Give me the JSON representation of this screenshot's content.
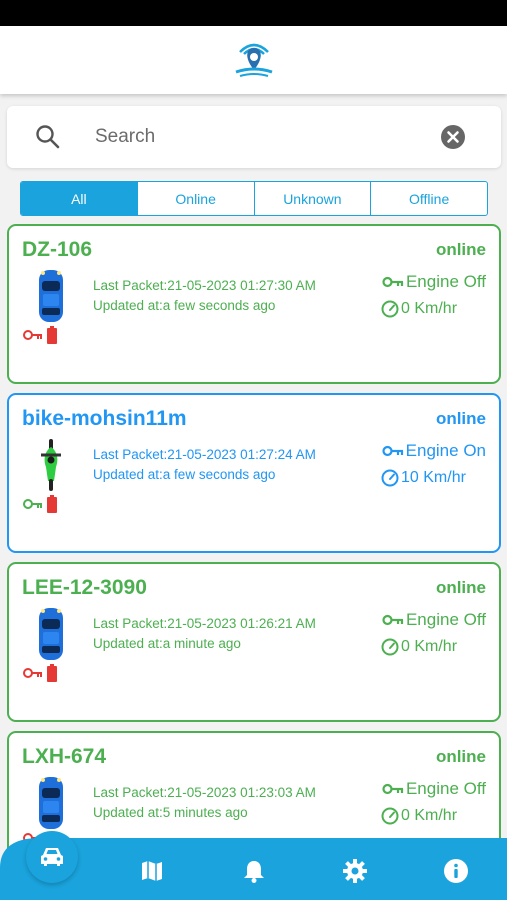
{
  "search": {
    "placeholder": "Search"
  },
  "tabs": [
    {
      "label": "All",
      "active": true
    },
    {
      "label": "Online"
    },
    {
      "label": "Unknown"
    },
    {
      "label": "Offline"
    }
  ],
  "vehicles": [
    {
      "name": "DZ-106",
      "status": "online",
      "last_packet": "Last Packet:21-05-2023 01:27:30 AM",
      "updated": "Updated at:a few seconds ago",
      "engine": "Engine Off",
      "speed": "0 Km/hr",
      "type": "car",
      "color": "#4caf50"
    },
    {
      "name": "bike-mohsin11m",
      "status": "online",
      "last_packet": "Last Packet:21-05-2023 01:27:24 AM",
      "updated": "Updated at:a few seconds ago",
      "engine": "Engine On",
      "speed": "10 Km/hr",
      "type": "bike",
      "color": "#2196f3"
    },
    {
      "name": "LEE-12-3090",
      "status": "online",
      "last_packet": "Last Packet:21-05-2023 01:26:21 AM",
      "updated": "Updated at:a minute ago",
      "engine": "Engine Off",
      "speed": "0 Km/hr",
      "type": "car",
      "color": "#4caf50"
    },
    {
      "name": "LXH-674",
      "status": "online",
      "last_packet": "Last Packet:21-05-2023 01:23:03 AM",
      "updated": "Updated at:5 minutes ago",
      "engine": "Engine Off",
      "speed": "0 Km/hr",
      "type": "car",
      "color": "#4caf50"
    }
  ],
  "nav": {
    "items": [
      "car-icon",
      "map-icon",
      "bell-icon",
      "gear-icon",
      "info-icon"
    ],
    "accent": "#1aa3dc"
  }
}
